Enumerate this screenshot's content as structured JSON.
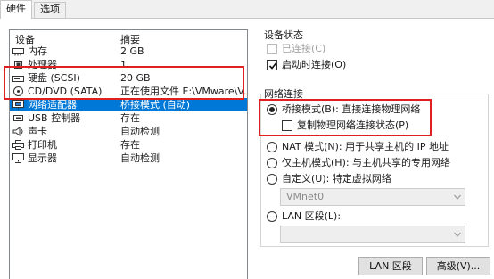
{
  "tabs": [
    "硬件",
    "选项"
  ],
  "device_list": {
    "headers": {
      "device": "设备",
      "summary": "摘要"
    },
    "rows": [
      {
        "icon": "memory-icon",
        "name": "内存",
        "summary": "2 GB"
      },
      {
        "icon": "cpu-icon",
        "name": "处理器",
        "summary": "1"
      },
      {
        "icon": "harddisk-icon",
        "name": "硬盘 (SCSI)",
        "summary": "20 GB"
      },
      {
        "icon": "cd-dvd-icon",
        "name": "CD/DVD (SATA)",
        "summary": "正在使用文件 E:\\VMware\\V..."
      },
      {
        "icon": "network-adapter-icon",
        "name": "网络适配器",
        "summary": "桥接模式 (自动)"
      },
      {
        "icon": "usb-icon",
        "name": "USB 控制器",
        "summary": "存在"
      },
      {
        "icon": "sound-card-icon",
        "name": "声卡",
        "summary": "自动检测"
      },
      {
        "icon": "printer-icon",
        "name": "打印机",
        "summary": "存在"
      },
      {
        "icon": "display-icon",
        "name": "显示器",
        "summary": "自动检测"
      }
    ],
    "selected_index": 4
  },
  "device_status": {
    "title": "设备状态",
    "connected": {
      "label": "已连接(C)",
      "checked": false,
      "enabled": false
    },
    "connect_at_power_on": {
      "label": "启动时连接(O)",
      "checked": true,
      "enabled": true
    }
  },
  "network_connection": {
    "title": "网络连接",
    "bridged": {
      "label": "桥接模式(B): 直接连接物理网络",
      "selected": true
    },
    "replicate_state": {
      "label": "复制物理网络连接状态(P)",
      "checked": false
    },
    "nat": {
      "label": "NAT 模式(N): 用于共享主机的 IP 地址",
      "selected": false
    },
    "host_only": {
      "label": "仅主机模式(H): 与主机共享的专用网络",
      "selected": false
    },
    "custom": {
      "label": "自定义(U): 特定虚拟网络",
      "selected": false,
      "value": "VMnet0"
    },
    "lan_segment": {
      "label": "LAN 区段(L):",
      "selected": false,
      "value": ""
    }
  },
  "buttons": {
    "lan_segments": "LAN 区段(S)...",
    "advanced": "高级(V)..."
  },
  "colors": {
    "selection": "#0078d7",
    "highlight_box": "#e02020"
  }
}
